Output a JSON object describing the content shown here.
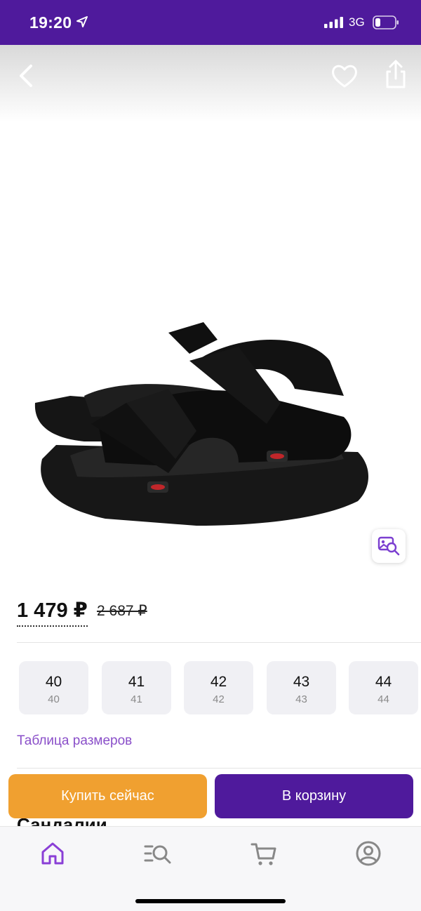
{
  "status_bar": {
    "time": "19:20",
    "network": "3G"
  },
  "colors": {
    "brand": "#4f1a9c",
    "accent_orange": "#f0a030",
    "link": "#8a4fc9"
  },
  "photo": {
    "icons": [
      "back-icon",
      "heart-icon",
      "share-icon",
      "visual-search-icon"
    ]
  },
  "price": {
    "current": "1 479 ₽",
    "old": "2 687 ₽"
  },
  "sizes": [
    {
      "main": "40",
      "sub": "40"
    },
    {
      "main": "41",
      "sub": "41"
    },
    {
      "main": "42",
      "sub": "42"
    },
    {
      "main": "43",
      "sub": "43"
    },
    {
      "main": "44",
      "sub": "44"
    }
  ],
  "size_table_link": "Таблица размеров",
  "product": {
    "name": "Сандалии"
  },
  "actions": {
    "buy_now": "Купить сейчас",
    "add_to_cart": "В корзину"
  },
  "tab_bar": {
    "tabs": [
      "home-icon",
      "catalog-search-icon",
      "cart-icon",
      "profile-icon"
    ],
    "active": "home-icon"
  }
}
